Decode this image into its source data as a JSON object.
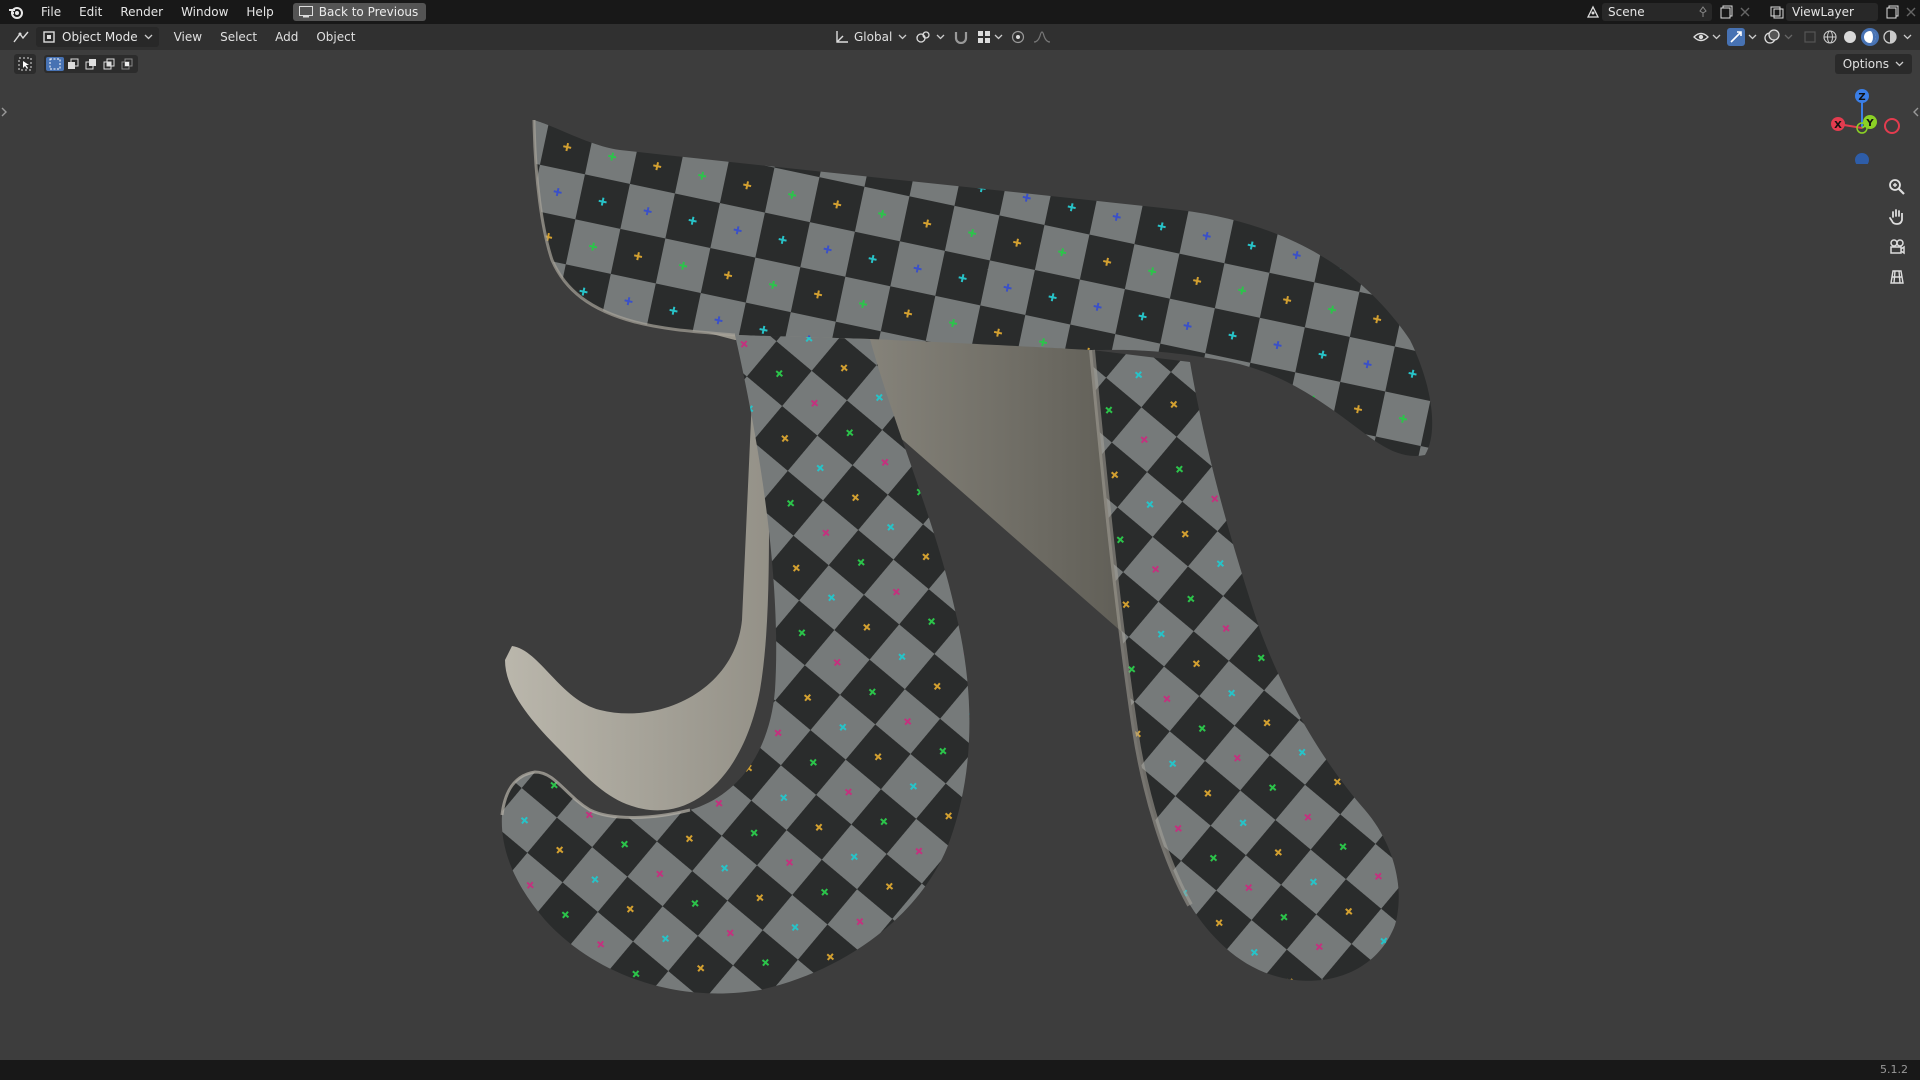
{
  "menu": {
    "items": [
      "File",
      "Edit",
      "Render",
      "Window",
      "Help"
    ],
    "back_label": "Back to Previous"
  },
  "top_right": {
    "scene": "Scene",
    "view_layer": "ViewLayer"
  },
  "header": {
    "mode": "Object Mode",
    "items": [
      "View",
      "Select",
      "Add",
      "Object"
    ],
    "transform_orientation": "Global"
  },
  "tools": {
    "options_label": "Options"
  },
  "gizmo": {
    "x_label": "X",
    "y_label": "Y",
    "z_label": "Z"
  },
  "status": {
    "version": "5.1.2"
  },
  "colors": {
    "accent": "#4772b3",
    "x_axis": "#e33c4f",
    "y_axis": "#8bd125",
    "z_axis": "#3a7ee6",
    "viewport_bg": "#3d3d3d"
  }
}
